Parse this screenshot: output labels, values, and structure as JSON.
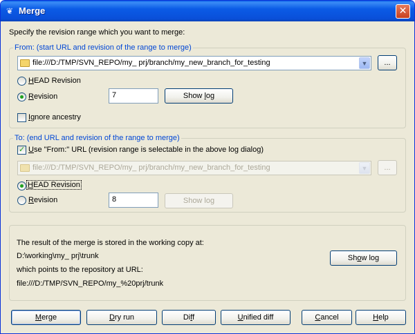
{
  "window": {
    "title": "Merge",
    "icon": "tortoise-icon",
    "close_glyph": "✕"
  },
  "instructions": "Specify the revision range which you want to merge:",
  "from": {
    "legend": "From: (start URL and revision of the range to merge)",
    "url": "file:///D:/TMP/SVN_REPO/my_ prj/branch/my_new_branch_for_testing",
    "browse_label": "...",
    "head_revision_label_pre": "",
    "head_revision_label_ul": "H",
    "head_revision_label_post": "EAD Revision",
    "revision_label_pre": "",
    "revision_label_ul": "R",
    "revision_label_post": "evision",
    "revision_value": "7",
    "show_log_pre": "Show ",
    "show_log_ul": "l",
    "show_log_post": "og",
    "ignore_ancestry_pre": "",
    "ignore_ancestry_ul": "I",
    "ignore_ancestry_post": "gnore ancestry",
    "selected": "revision",
    "ignore_ancestry_checked": false
  },
  "to": {
    "legend": "To: (end URL and revision of the range to merge)",
    "use_from_url_pre": "",
    "use_from_url_ul": "U",
    "use_from_url_post": "se \"From:\" URL (revision range is selectable in the above log dialog)",
    "use_from_url_checked": true,
    "url": "file:///D:/TMP/SVN_REPO/my_ prj/branch/my_new_branch_for_testing",
    "browse_label": "...",
    "head_revision_label_pre": "",
    "head_revision_label_ul": "H",
    "head_revision_label_post": "EAD Revision",
    "revision_label_pre": "",
    "revision_label_ul": "R",
    "revision_label_post": "evision",
    "revision_value": "8",
    "show_log_label": "Show log",
    "selected": "head"
  },
  "result": {
    "line1": "The result of the merge is stored in the working copy at:",
    "working_copy": "D:\\working\\my_ prj\\trunk",
    "line2": "which points to the repository at URL:",
    "repo_url": "file:///D:/TMP/SVN_REPO/my_%20prj/trunk",
    "show_log_pre": "Sh",
    "show_log_ul": "o",
    "show_log_post": "w log"
  },
  "buttons": {
    "merge_ul": "M",
    "merge_post": "erge",
    "dry_run_ul": "D",
    "dry_run_post": "ry run",
    "diff_pre": "Di",
    "diff_ul": "f",
    "diff_post": "f",
    "unified_diff_ul": "U",
    "unified_diff_post": "nified diff",
    "cancel_ul": "C",
    "cancel_post": "ancel",
    "help_ul": "H",
    "help_post": "elp"
  },
  "colors": {
    "dialog_bg": "#ece9d8",
    "title_bar": "#0a5fe8",
    "legend_text": "#0046d5",
    "radio_dot": "#21a121"
  }
}
